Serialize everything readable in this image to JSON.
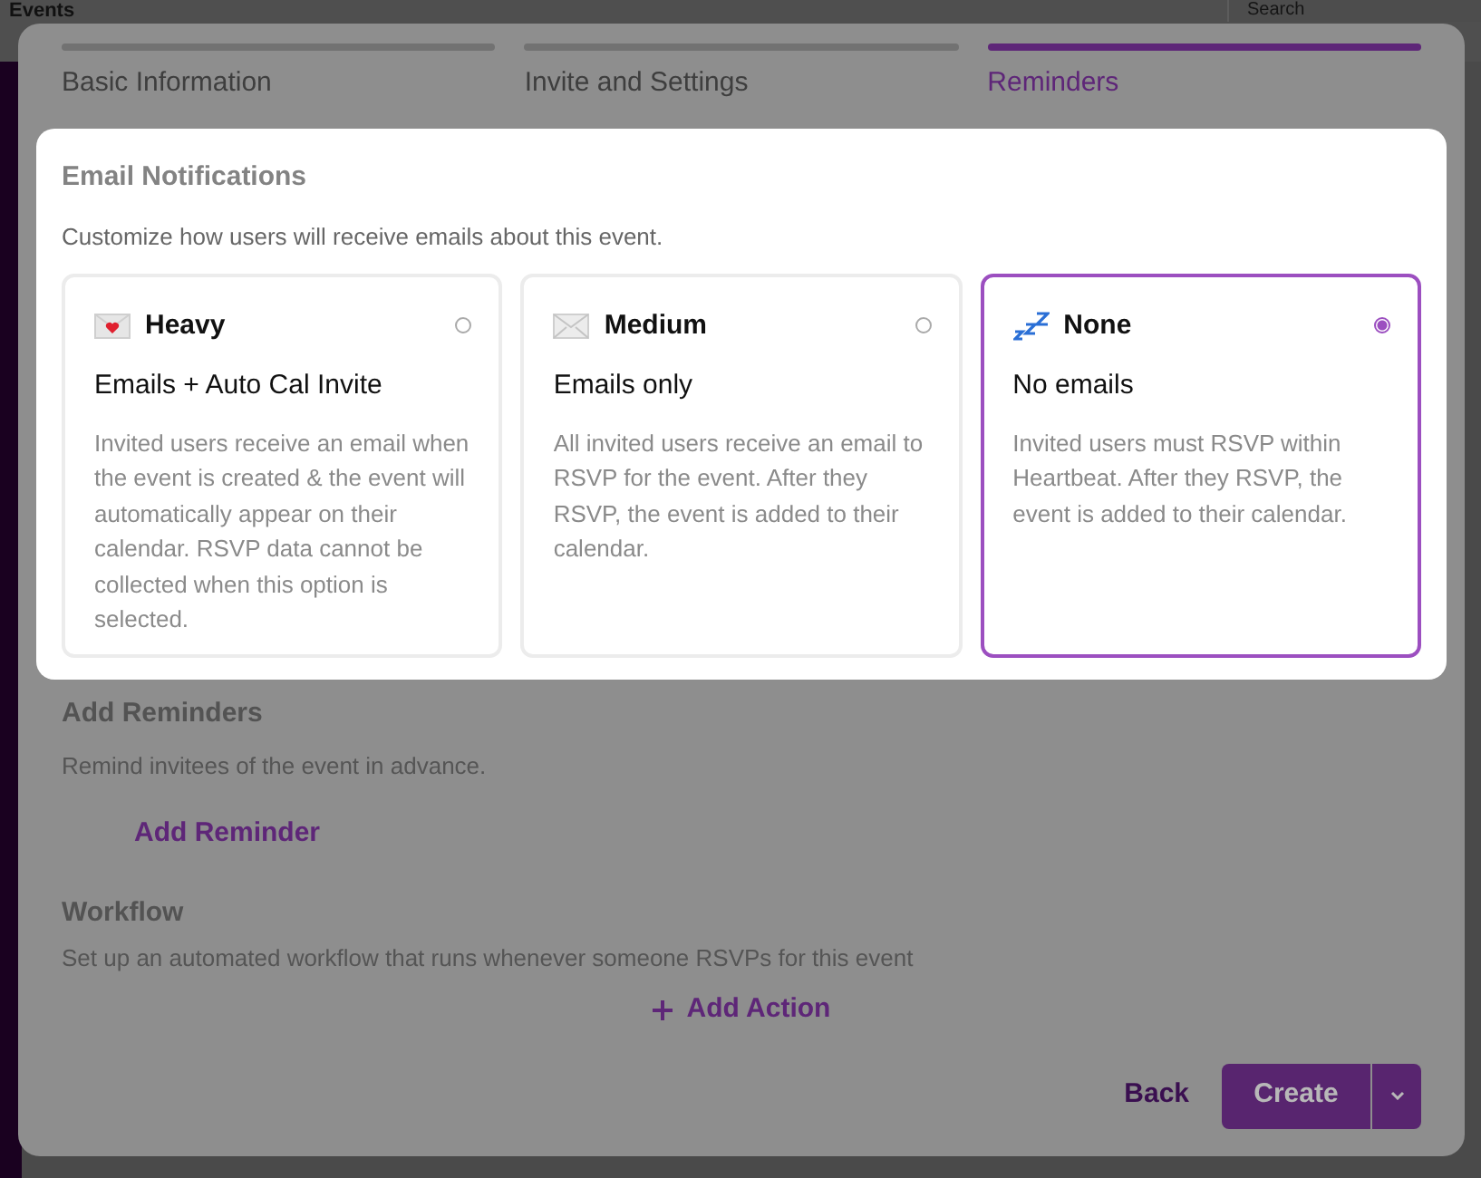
{
  "background": {
    "page_title": "Events",
    "search": {
      "placeholder": "Search"
    }
  },
  "steps": [
    {
      "label": "Basic Information",
      "selected": false
    },
    {
      "label": "Invite and Settings",
      "selected": false
    },
    {
      "label": "Reminders",
      "selected": true
    }
  ],
  "email_notifications": {
    "title": "Email Notifications",
    "subtitle": "Customize how users will receive emails about this event.",
    "options": [
      {
        "kind": "heart-envelope",
        "title": "Heavy",
        "subtitle": "Emails + Auto Cal Invite",
        "description": "Invited users receive an email when the event is created & the event will automatically appear on their calendar. RSVP data cannot be collected when this option is selected.",
        "selected": false
      },
      {
        "kind": "envelope",
        "title": "Medium",
        "subtitle": "Emails only",
        "description": "All invited users receive an email to RSVP for the event. After they RSVP, the event is added to their calendar.",
        "selected": false
      },
      {
        "kind": "sleep",
        "title": "None",
        "subtitle": "No emails",
        "description": "Invited users must RSVP within Heartbeat. After they RSVP, the event is added to their calendar.",
        "selected": true
      }
    ]
  },
  "reminders": {
    "title": "Add Reminders",
    "subtitle": "Remind invitees of the event in advance.",
    "add_button": "Add Reminder"
  },
  "workflow": {
    "title": "Workflow",
    "subtitle": "Set up an automated workflow that runs whenever someone RSVPs for this event",
    "add_button": "Add Action"
  },
  "footer": {
    "back_button": "Back",
    "create_button": "Create"
  }
}
